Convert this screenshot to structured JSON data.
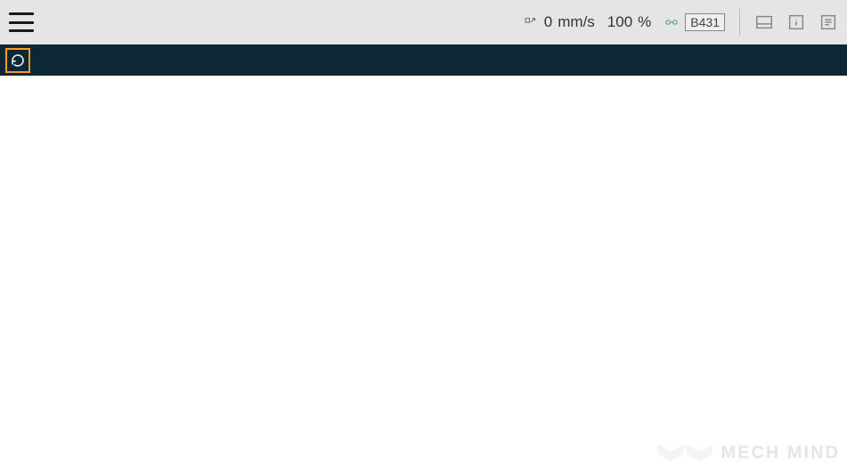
{
  "topbar": {
    "speed_value": "0",
    "speed_unit": "mm/s",
    "override_value": "100",
    "override_unit": "%",
    "robot_id": "B431"
  },
  "watermark": {
    "text": "MECH MIND"
  }
}
